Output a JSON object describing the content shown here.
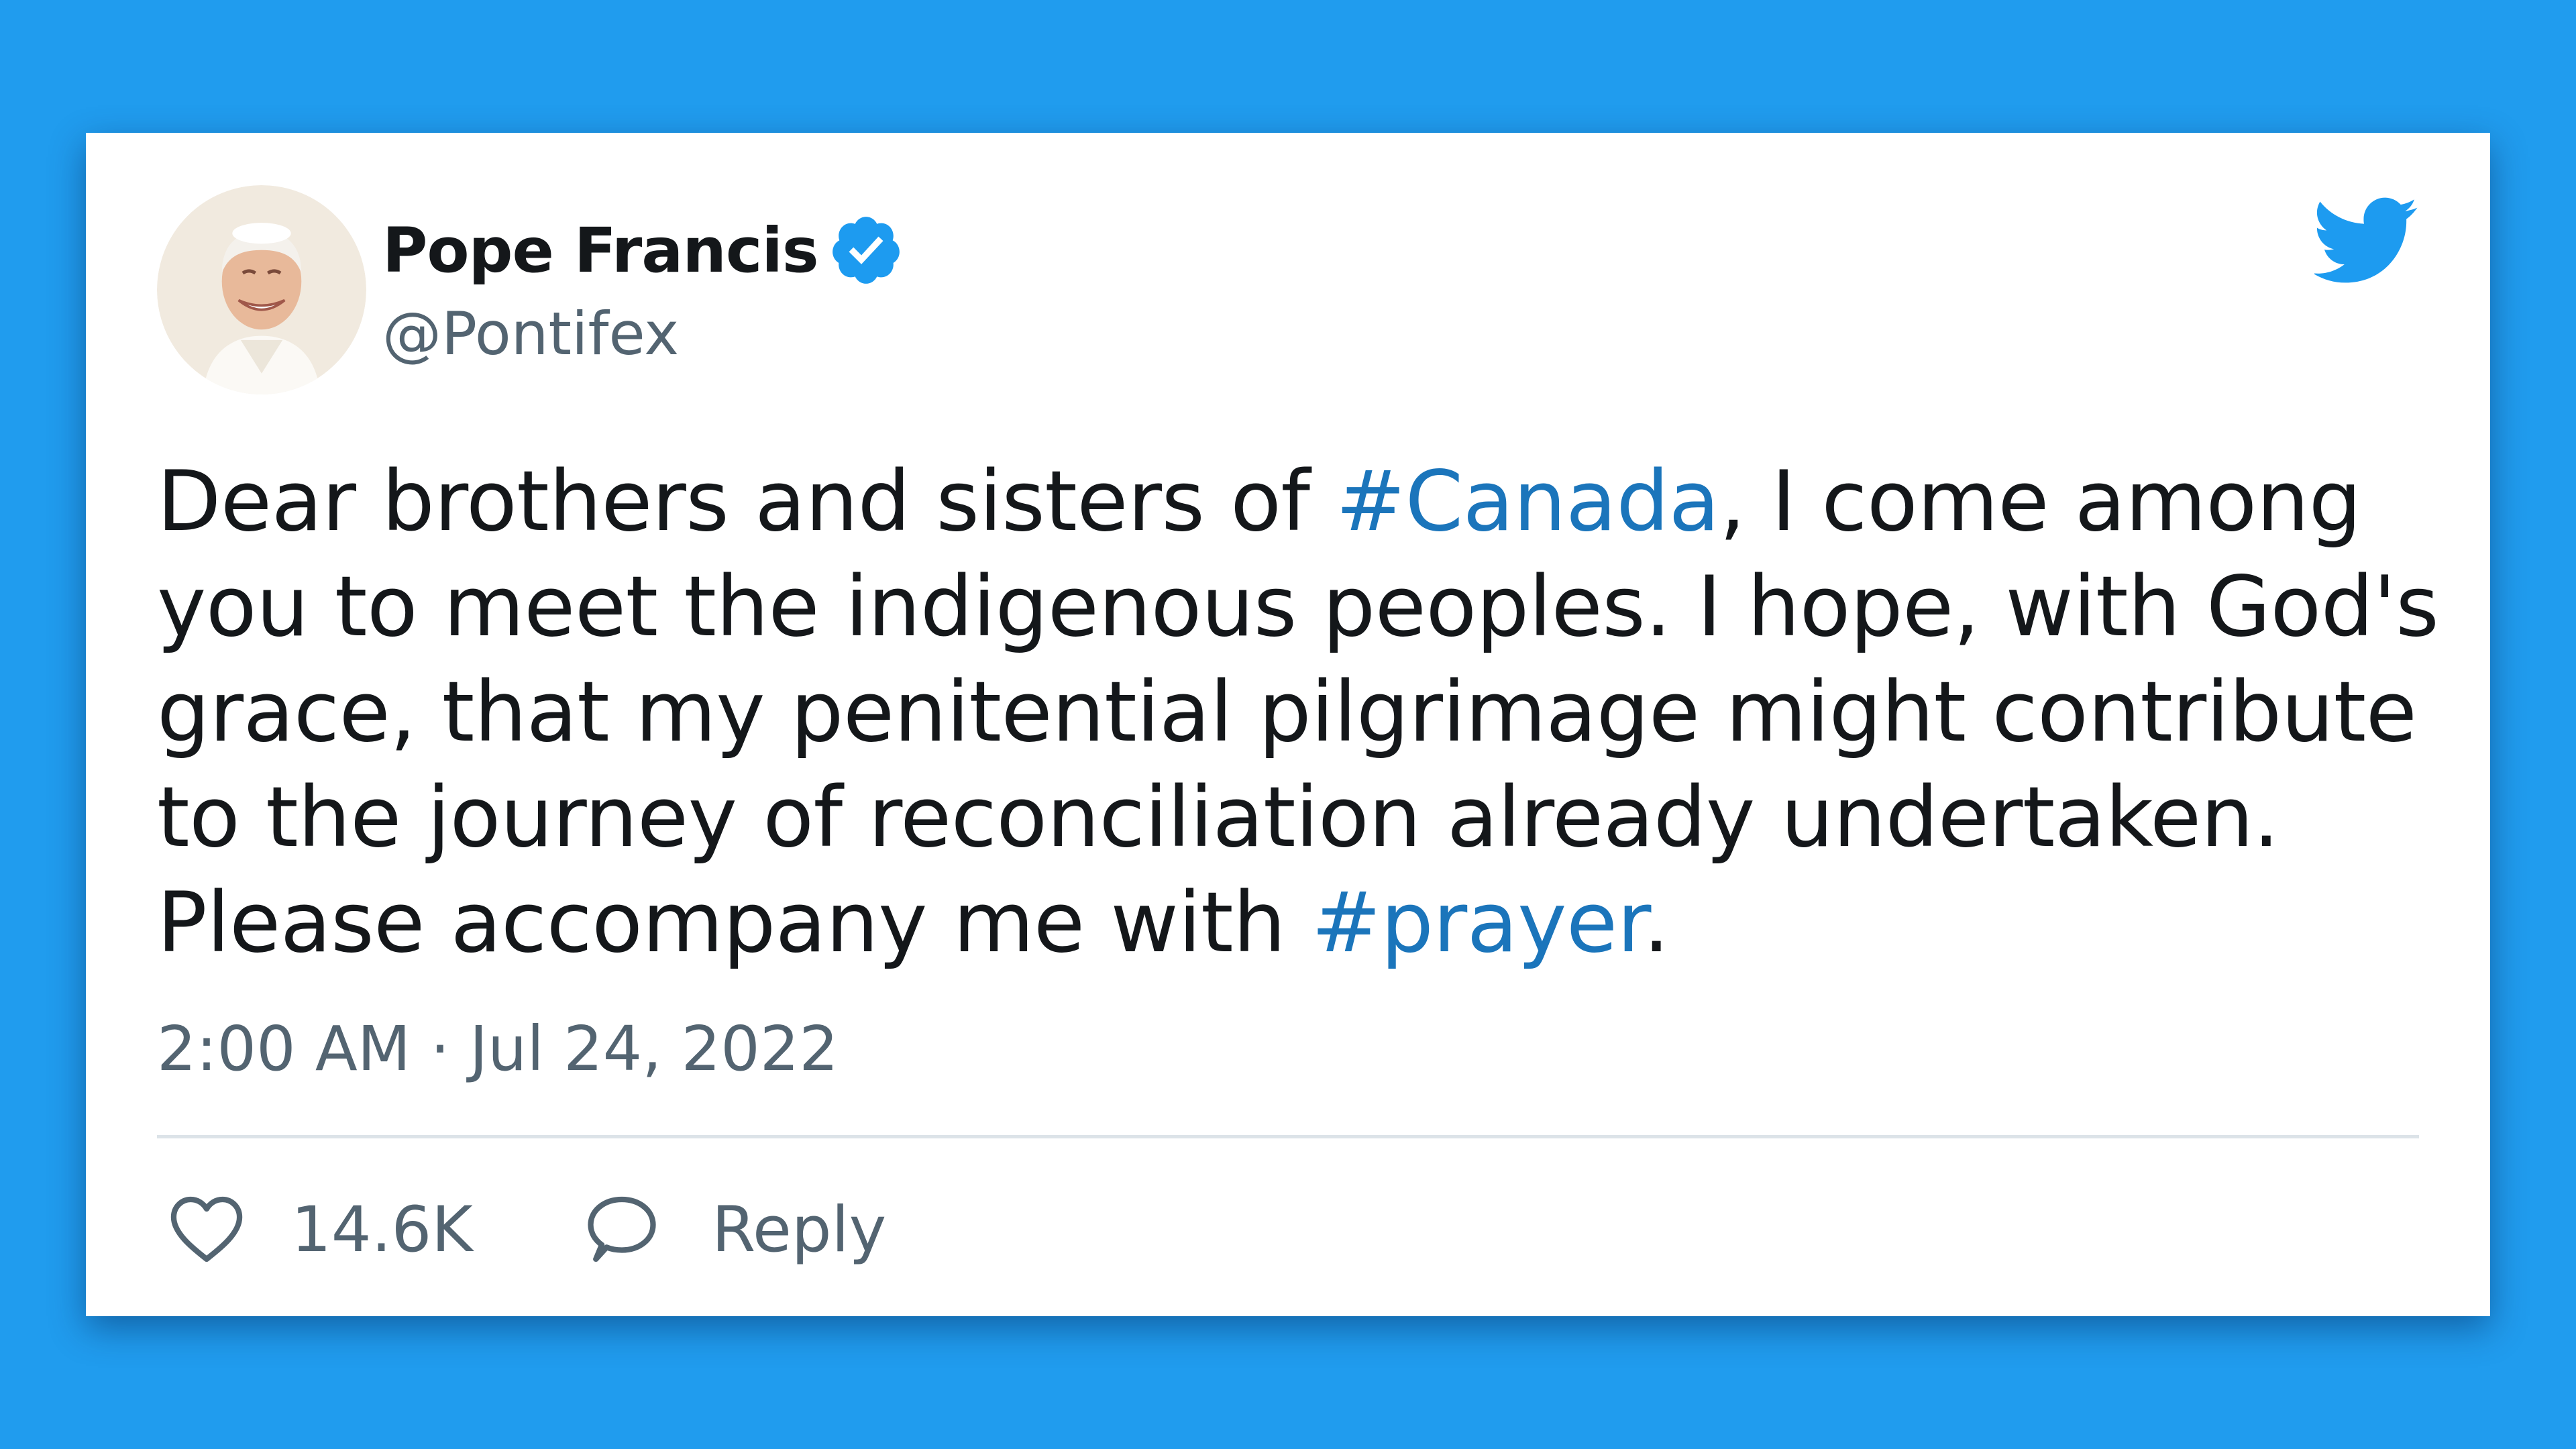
{
  "tweet": {
    "author": {
      "display_name": "Pope Francis",
      "handle": "@Pontifex",
      "verified": true,
      "avatar": "avatar-photo"
    },
    "text_lines": [
      [
        {
          "text": "Dear brothers and sisters of "
        },
        {
          "text": "#Canada",
          "hashtag": true
        },
        {
          "text": ", I come among"
        }
      ],
      [
        {
          "text": "you to meet the indigenous peoples. I hope, with God's"
        }
      ],
      [
        {
          "text": "grace, that my penitential pilgrimage might contribute"
        }
      ],
      [
        {
          "text": "to the journey of reconciliation already undertaken."
        }
      ],
      [
        {
          "text": "Please accompany me with "
        },
        {
          "text": "#prayer",
          "hashtag": true
        },
        {
          "text": "."
        }
      ]
    ],
    "timestamp": "2:00 AM · Jul 24, 2022",
    "likes": "14.6K",
    "reply_label": "Reply"
  },
  "icons": {
    "brand": "twitter-bird-icon",
    "verified": "verified-badge-icon",
    "like": "heart-icon",
    "reply": "reply-bubble-icon"
  },
  "colors": {
    "background": "#209cee",
    "card": "#ffffff",
    "text": "#14171a",
    "secondary_text": "#536471",
    "hashtag": "#1b75bb",
    "brand_blue": "#1d9bf0",
    "divider": "#dce3e8"
  }
}
